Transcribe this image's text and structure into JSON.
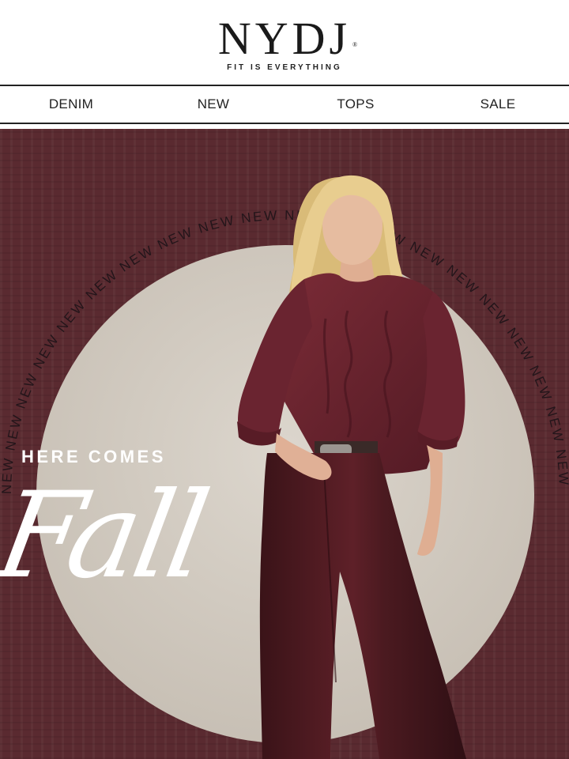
{
  "brand": {
    "logo": "NYDJ",
    "registered": "®",
    "tagline": "FIT IS EVERYTHING"
  },
  "nav": {
    "items": [
      {
        "label": "DENIM"
      },
      {
        "label": "NEW"
      },
      {
        "label": "TOPS"
      },
      {
        "label": "SALE"
      }
    ]
  },
  "hero": {
    "ring_word": "NEW",
    "ring_text": "NEW NEW NEW NEW NEW NEW NEW NEW NEW NEW NEW NEW NEW NEW NEW NEW NEW NEW NEW NEW",
    "headline_small": "HERE COMES",
    "headline_script": "Fall",
    "colors": {
      "background": "#5a2a30",
      "circle": "#d5cfc6",
      "sweater": "#6b2530",
      "pants": "#4a1a20",
      "hair": "#e3c98a",
      "skin": "#e4b89c",
      "text": "#ffffff"
    }
  }
}
